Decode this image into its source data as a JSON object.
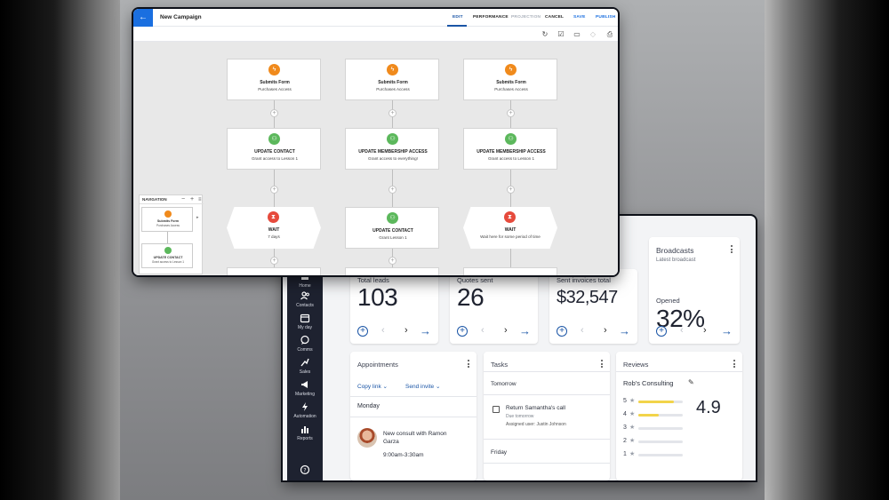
{
  "campaign": {
    "title": "New Campaign",
    "tabs": {
      "edit": "EDIT",
      "performance": "PERFORMANCE",
      "projection": "PROJECTION"
    },
    "actions": {
      "cancel": "CANCEL",
      "save": "SAVE",
      "publish": "PUBLISH"
    },
    "columns": [
      {
        "trigger": {
          "title": "Submits Form",
          "sub": "Purchases Access"
        },
        "step2": {
          "title": "UPDATE CONTACT",
          "sub": "Grant access to Lesson 1"
        },
        "step3": {
          "title": "WAIT",
          "sub": "7 days"
        }
      },
      {
        "trigger": {
          "title": "Submits Form",
          "sub": "Purchases Access"
        },
        "step2": {
          "title": "UPDATE MEMBERSHIP ACCESS",
          "sub": "Grant access to everything!"
        },
        "step3": {
          "title": "UPDATE CONTACT",
          "sub": "Grant Lesson 1"
        }
      },
      {
        "trigger": {
          "title": "Submits Form",
          "sub": "Purchases Access"
        },
        "step2": {
          "title": "UPDATE MEMBERSHIP ACCESS",
          "sub": "Grant access to Lesson 1"
        },
        "step3": {
          "title": "WAIT",
          "sub": "Wait here for some period of time"
        }
      }
    ],
    "navigation": {
      "title": "NAVIGATION",
      "mini1": {
        "title": "Submits Form",
        "sub": "Purchases Access"
      },
      "mini2": {
        "title": "UPDATE CONTACT",
        "sub": "Grant access to Lesson 1"
      }
    }
  },
  "sidebar": {
    "items": [
      {
        "label": "Home",
        "icon": "home-icon"
      },
      {
        "label": "Contacts",
        "icon": "contacts-icon"
      },
      {
        "label": "My day",
        "icon": "calendar-icon"
      },
      {
        "label": "Comms",
        "icon": "chat-icon"
      },
      {
        "label": "Sales",
        "icon": "sales-icon"
      },
      {
        "label": "Marketing",
        "icon": "megaphone-icon"
      },
      {
        "label": "Automation",
        "icon": "lightning-icon"
      },
      {
        "label": "Reports",
        "icon": "reports-icon"
      }
    ]
  },
  "stats": {
    "leads": {
      "title": "Total leads",
      "value": "103"
    },
    "quotes": {
      "title": "Quotes sent",
      "value": "26"
    },
    "invoices": {
      "title": "Sent invoices total",
      "value": "$32,547"
    },
    "broadcasts": {
      "title": "Broadcasts",
      "sub": "Latest broadcast",
      "label": "Opened",
      "value": "32%"
    }
  },
  "appointments": {
    "title": "Appointments",
    "copy_link": "Copy link",
    "send_invite": "Send invite",
    "day": "Monday",
    "event": "New consult with Ramon Garza",
    "time": "9:00am-3:30am"
  },
  "tasks": {
    "title": "Tasks",
    "tomorrow": "Tomorrow",
    "task_title": "Return Samantha's call",
    "task_due": "Due tomorrow",
    "task_assigned": "Assigned user: Justin Johnson",
    "friday": "Friday"
  },
  "reviews": {
    "title": "Reviews",
    "business": "Rob's Consulting",
    "rating": "4.9",
    "rows": [
      {
        "stars": "5",
        "fraction": 0.8
      },
      {
        "stars": "4",
        "fraction": 0.45
      },
      {
        "stars": "3",
        "fraction": 0
      },
      {
        "stars": "2",
        "fraction": 0
      },
      {
        "stars": "1",
        "fraction": 0
      }
    ]
  },
  "colors": {
    "accent": "#1a55a6",
    "primary_blue": "#1a6fe0",
    "trigger": "#f08a1c",
    "action": "#5cb85c",
    "wait": "#e64a3c",
    "star": "#f2d44a"
  }
}
